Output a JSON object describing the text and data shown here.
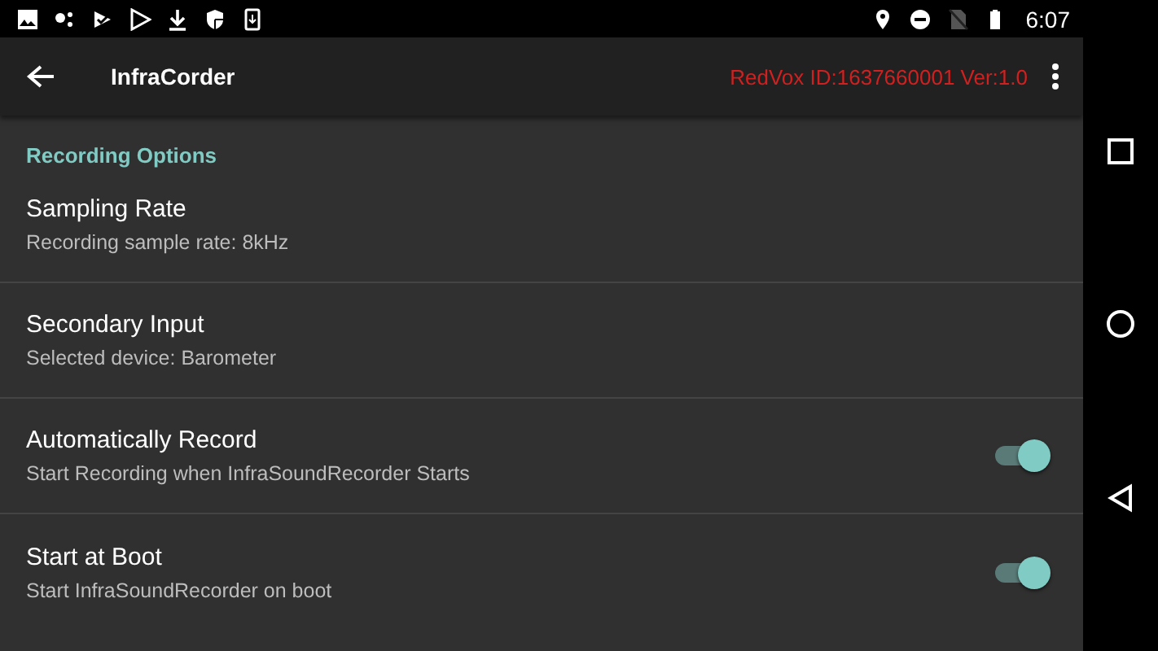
{
  "status_bar": {
    "time": "6:07"
  },
  "app_bar": {
    "title": "InfraCorder",
    "device_info": "RedVox ID:1637660001 Ver:1.0"
  },
  "section": {
    "title": "Recording Options"
  },
  "settings": [
    {
      "kind": "text",
      "title": "Sampling Rate",
      "summary": "Recording sample rate: 8kHz"
    },
    {
      "kind": "text",
      "title": "Secondary Input",
      "summary": "Selected device: Barometer"
    },
    {
      "kind": "switch",
      "title": "Automatically Record",
      "summary": "Start Recording when InfraSoundRecorder Starts",
      "on": true
    },
    {
      "kind": "switch",
      "title": "Start at Boot",
      "summary": "Start InfraSoundRecorder on boot",
      "on": true
    }
  ]
}
